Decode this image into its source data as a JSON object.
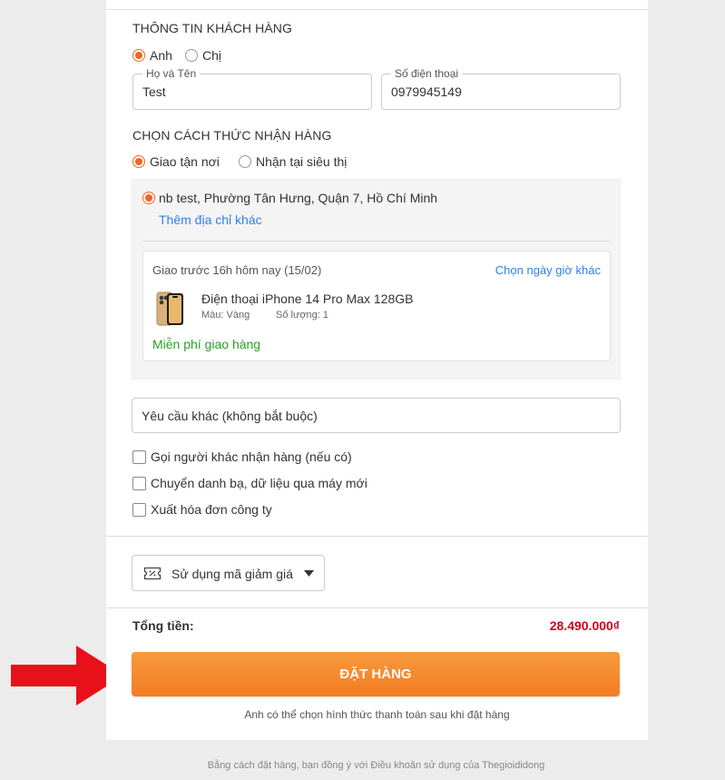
{
  "customer": {
    "section_title": "THÔNG TIN KHÁCH HÀNG",
    "salutation": {
      "option_male": "Anh",
      "option_female": "Chị",
      "selected": "Anh"
    },
    "name_field": {
      "legend": "Họ và Tên",
      "value": "Test"
    },
    "phone_field": {
      "legend": "Số điện thoại",
      "value": "0979945149"
    }
  },
  "delivery": {
    "section_title": "CHỌN CÁCH THỨC NHẬN HÀNG",
    "option_home": "Giao tận nơi",
    "option_store": "Nhận tại siêu thị",
    "selected": "Giao tận nơi",
    "address": "nb test, Phường Tân Hưng, Quận 7, Hồ Chí Minh",
    "add_address_link": "Thêm địa chỉ khác",
    "schedule": {
      "text": "Giao trước 16h hôm nay (15/02)",
      "change_link": "Chọn ngày giờ khác"
    },
    "product": {
      "name": "Điện thoại iPhone 14 Pro Max 128GB",
      "color": "Màu: Vàng",
      "quantity": "Số lượng: 1"
    },
    "shipping_note": "Miễn phí giao hàng"
  },
  "other_request": {
    "placeholder": "Yêu cầu khác (không bắt buộc)"
  },
  "options": [
    {
      "label": "Gọi người khác nhận hàng (nếu có)"
    },
    {
      "label": "Chuyển danh bạ, dữ liệu qua máy mới"
    },
    {
      "label": "Xuất hóa đơn công ty"
    }
  ],
  "coupon": {
    "label": "Sử dụng mã giảm giá",
    "icon": "ticket-icon"
  },
  "total": {
    "label": "Tổng tiền:",
    "value": "28.490.000₫"
  },
  "order_button": {
    "label": "ĐẶT HÀNG"
  },
  "payment_note": "Anh có thể chọn hình thức thanh toán sau khi đặt hàng",
  "terms_note": "Bằng cách đặt hàng, bạn đồng ý với Điều khoản sử dụng của Thegioididong",
  "colors": {
    "accent": "#f06522",
    "button": "#f58a2e",
    "price": "#d0021b",
    "link": "#2f80ed",
    "success": "#27a31f",
    "arrow": "#e8111a"
  }
}
